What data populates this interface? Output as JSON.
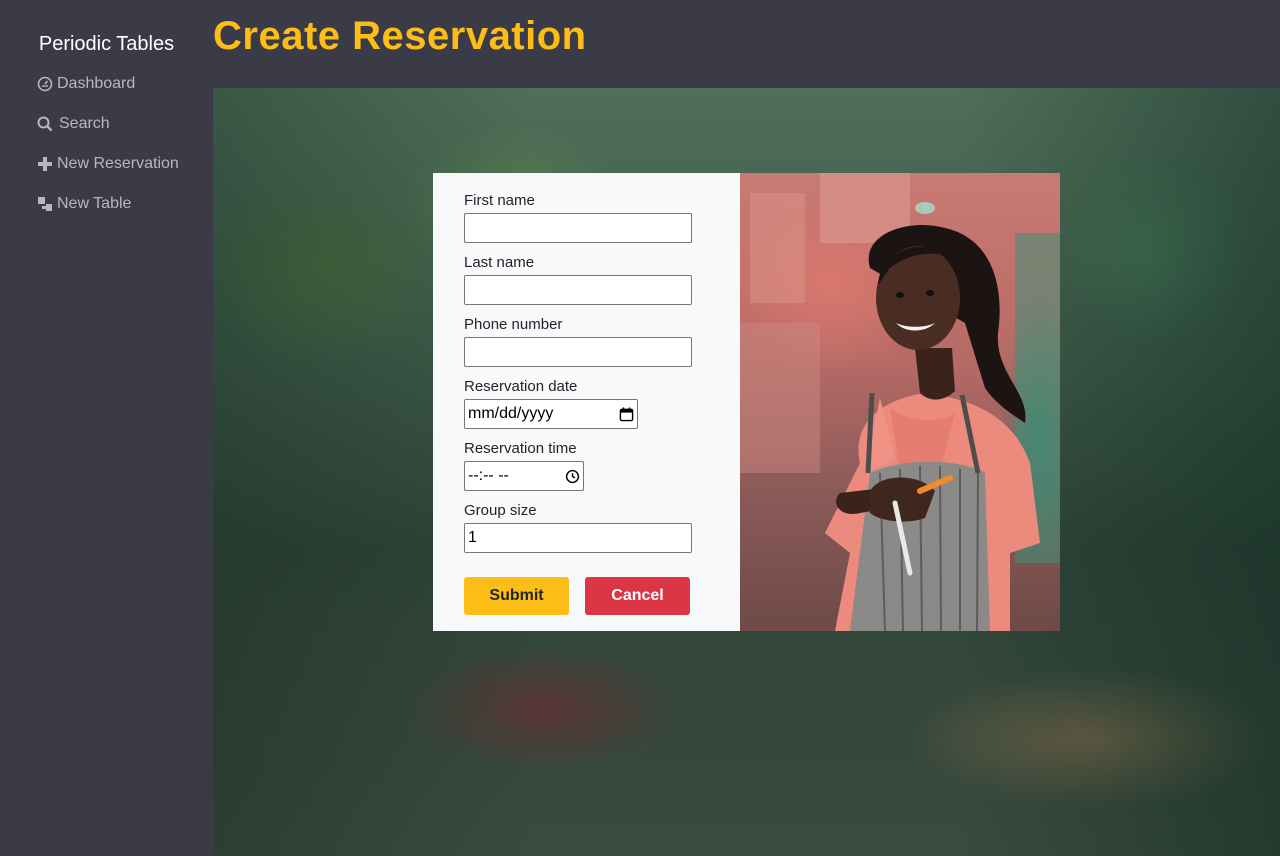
{
  "sidebar": {
    "brand": "Periodic Tables",
    "items": [
      {
        "label": "Dashboard",
        "icon": "dashboard-icon"
      },
      {
        "label": "Search",
        "icon": "search-icon"
      },
      {
        "label": "New Reservation",
        "icon": "plus-icon"
      },
      {
        "label": "New Table",
        "icon": "table-icon"
      }
    ]
  },
  "header": {
    "title": "Create Reservation"
  },
  "form": {
    "first_name": {
      "label": "First name",
      "value": ""
    },
    "last_name": {
      "label": "Last name",
      "value": ""
    },
    "phone": {
      "label": "Phone number",
      "value": ""
    },
    "date": {
      "label": "Reservation date",
      "placeholder": "mm/dd/yyyy"
    },
    "time": {
      "label": "Reservation time",
      "placeholder": "--:-- --"
    },
    "group_size": {
      "label": "Group size",
      "value": "1"
    },
    "submit_label": "Submit",
    "cancel_label": "Cancel"
  },
  "colors": {
    "accent": "#fbbd16",
    "danger": "#dc3545",
    "background": "#3b3b47"
  }
}
